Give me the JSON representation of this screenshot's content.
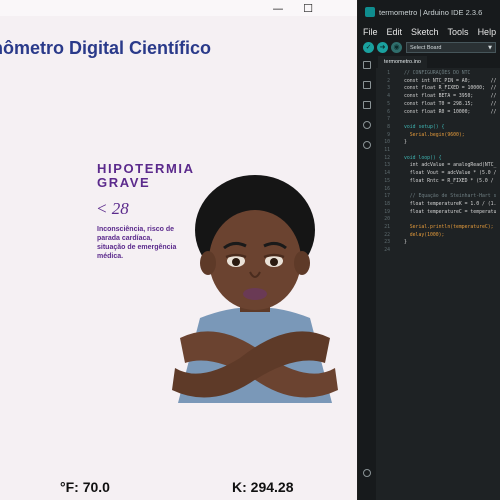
{
  "left_window": {
    "title_partial": "hômetro Digital Científico",
    "controls": {
      "minimize": "—",
      "maximize": "☐"
    },
    "status": {
      "title_line1": "HIPOTERMIA",
      "title_line2": "GRAVE",
      "range": "< 28",
      "description": "Inconsciência, risco de parada cardíaca, situação de emergência médica."
    },
    "readouts": {
      "fahrenheit": "°F: 70.0",
      "kelvin": "K: 294.28"
    }
  },
  "ide": {
    "title": "termometro | Arduino IDE 2.3.6",
    "menu": [
      "File",
      "Edit",
      "Sketch",
      "Tools",
      "Help"
    ],
    "board_select": "Select Board",
    "file_tab": "termometro.ino",
    "code_lines": [
      {
        "n": "1",
        "text": "// CONFIGURAÇÕES DO NTC",
        "type": "comment"
      },
      {
        "n": "2",
        "text": "const int NTC_PIN = A0;       //",
        "type": "code"
      },
      {
        "n": "3",
        "text": "const float R_FIXED = 10000;  //",
        "type": "code"
      },
      {
        "n": "4",
        "text": "const float BETA = 3950;      //",
        "type": "code"
      },
      {
        "n": "5",
        "text": "const float T0 = 298.15;      //",
        "type": "code"
      },
      {
        "n": "6",
        "text": "const float R0 = 10000;       //",
        "type": "code"
      },
      {
        "n": "7",
        "text": "",
        "type": "code"
      },
      {
        "n": "8",
        "text": "void setup() {",
        "type": "kw"
      },
      {
        "n": "9",
        "text": "  Serial.begin(9600);",
        "type": "fn"
      },
      {
        "n": "10",
        "text": "}",
        "type": "code"
      },
      {
        "n": "11",
        "text": "",
        "type": "code"
      },
      {
        "n": "12",
        "text": "void loop() {",
        "type": "kw"
      },
      {
        "n": "13",
        "text": "  int adcValue = analogRead(NTC_",
        "type": "code"
      },
      {
        "n": "14",
        "text": "  float Vout = adcValue * (5.0 /",
        "type": "code"
      },
      {
        "n": "15",
        "text": "  float Rntc = R_FIXED * (5.0 /",
        "type": "code"
      },
      {
        "n": "16",
        "text": "",
        "type": "code"
      },
      {
        "n": "17",
        "text": "  // Equação de Steinhart-Hart s",
        "type": "comment"
      },
      {
        "n": "18",
        "text": "  float temperatureK = 1.0 / (1.",
        "type": "code"
      },
      {
        "n": "19",
        "text": "  float temperatureC = temperatu",
        "type": "code"
      },
      {
        "n": "20",
        "text": "",
        "type": "code"
      },
      {
        "n": "21",
        "text": "  Serial.println(temperatureC);",
        "type": "fn"
      },
      {
        "n": "22",
        "text": "  delay(1000);",
        "type": "fn"
      },
      {
        "n": "23",
        "text": "}",
        "type": "code"
      },
      {
        "n": "24",
        "text": "",
        "type": "code"
      }
    ]
  },
  "icons": {
    "verify": "check-icon",
    "upload": "arrow-right-icon",
    "debug": "debug-icon"
  },
  "colors": {
    "title_blue": "#2a3a8a",
    "status_purple": "#5b2a8c",
    "ide_accent": "#1aa19f",
    "ide_background": "#1e2224"
  }
}
